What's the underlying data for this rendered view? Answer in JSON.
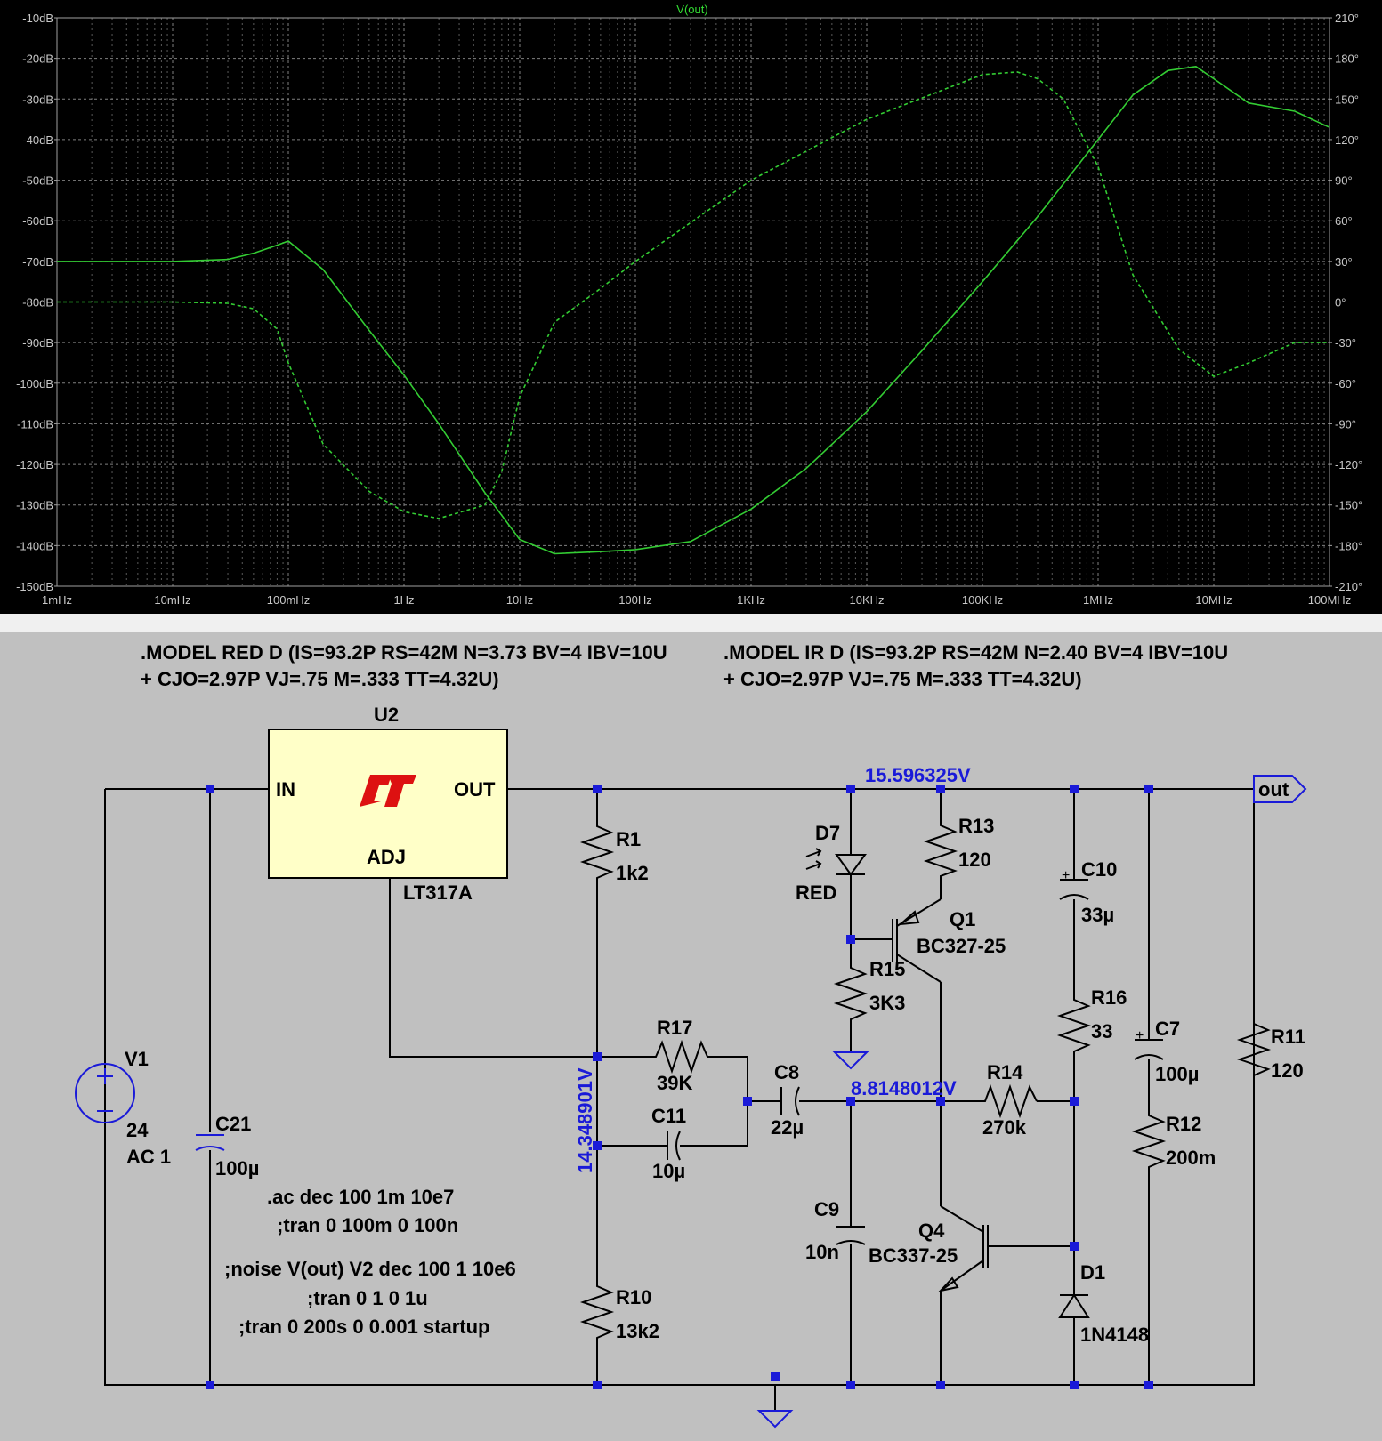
{
  "plot": {
    "trace_name": "V(out)",
    "y_left_ticks": [
      "-10dB",
      "-20dB",
      "-30dB",
      "-40dB",
      "-50dB",
      "-60dB",
      "-70dB",
      "-80dB",
      "-90dB",
      "-100dB",
      "-110dB",
      "-120dB",
      "-130dB",
      "-140dB",
      "-150dB"
    ],
    "y_right_ticks": [
      "210°",
      "180°",
      "150°",
      "120°",
      "90°",
      "60°",
      "30°",
      "0°",
      "-30°",
      "-60°",
      "-90°",
      "-120°",
      "-150°",
      "-180°",
      "-210°"
    ],
    "x_ticks": [
      "1mHz",
      "10mHz",
      "100mHz",
      "1Hz",
      "10Hz",
      "100Hz",
      "1KHz",
      "10KHz",
      "100KHz",
      "1MHz",
      "10MHz",
      "100MHz"
    ],
    "colors": {
      "background": "#000000",
      "grid": "#808080",
      "trace": "#33cc33",
      "axis_text": "#c8c8c8"
    }
  },
  "chart_data": {
    "type": "line",
    "title": "V(out)",
    "xscale": "log",
    "xlim": [
      0.001,
      100000000
    ],
    "ylim": [
      -150,
      -10
    ],
    "y2lim": [
      -210,
      210
    ],
    "grid": true,
    "series": [
      {
        "name": "V(out)",
        "axis": "magnitude_dB",
        "style": "solid",
        "x": [
          0.001,
          0.01,
          0.03,
          0.05,
          0.08,
          0.1,
          0.2,
          0.5,
          1,
          2,
          5,
          10,
          20,
          50,
          100,
          300,
          1000,
          3000,
          10000,
          30000,
          100000,
          300000,
          1000000,
          2000000,
          4000000,
          7000000,
          10000000,
          20000000,
          50000000,
          100000000
        ],
        "y": [
          -70,
          -70,
          -69.5,
          -68,
          -66,
          -65,
          -72,
          -87,
          -98,
          -110,
          -127,
          -138.5,
          -142,
          -141.5,
          -141,
          -139,
          -131,
          -121,
          -107,
          -92,
          -75,
          -59,
          -40,
          -29,
          -23,
          -22,
          -25,
          -31,
          -33,
          -37
        ]
      },
      {
        "name": "V(out)",
        "axis": "phase_deg",
        "style": "dashed",
        "x": [
          0.001,
          0.01,
          0.03,
          0.05,
          0.08,
          0.1,
          0.2,
          0.5,
          1,
          2,
          5,
          7,
          10,
          20,
          50,
          100,
          1000,
          10000,
          100000,
          200000,
          300000,
          500000,
          1000000,
          2000000,
          5000000,
          10000000,
          20000000,
          50000000,
          100000000
        ],
        "y": [
          0,
          0,
          -1,
          -5,
          -20,
          -45,
          -105,
          -140,
          -155,
          -160,
          -150,
          -125,
          -70,
          -15,
          10,
          30,
          90,
          135,
          168,
          170,
          165,
          150,
          100,
          20,
          -35,
          -55,
          -45,
          -30,
          -30
        ]
      }
    ]
  },
  "schematic": {
    "model_red_line1": ".MODEL RED D (IS=93.2P RS=42M N=3.73 BV=4 IBV=10U",
    "model_red_line2": "+ CJO=2.97P VJ=.75 M=.333 TT=4.32U)",
    "model_ir_line1": ".MODEL IR D (IS=93.2P RS=42M N=2.40 BV=4 IBV=10U",
    "model_ir_line2": "+ CJO=2.97P VJ=.75 M=.333 TT=4.32U)",
    "u2": {
      "ref": "U2",
      "part": "LT317A",
      "pin_in": "IN",
      "pin_out": "OUT",
      "pin_adj": "ADJ",
      "logo": "LT"
    },
    "net_voltages": {
      "top_rail": "15.596325V",
      "adj": "14.348901V",
      "mid": "8.8148012V"
    },
    "out_label": "out",
    "components": {
      "v1": {
        "ref": "V1",
        "value": "24",
        "value2": "AC 1"
      },
      "c21": {
        "ref": "C21",
        "value": "100µ"
      },
      "r1": {
        "ref": "R1",
        "value": "1k2"
      },
      "r10": {
        "ref": "R10",
        "value": "13k2"
      },
      "r17": {
        "ref": "R17",
        "value": "39K"
      },
      "c11": {
        "ref": "C11",
        "value": "10µ"
      },
      "c8": {
        "ref": "C8",
        "value": "22µ"
      },
      "c9": {
        "ref": "C9",
        "value": "10n"
      },
      "d7": {
        "ref": "D7",
        "value": "RED"
      },
      "r15": {
        "ref": "R15",
        "value": "3K3"
      },
      "r13": {
        "ref": "R13",
        "value": "120"
      },
      "q1": {
        "ref": "Q1",
        "value": "BC327-25"
      },
      "q4": {
        "ref": "Q4",
        "value": "BC337-25"
      },
      "r14": {
        "ref": "R14",
        "value": "270k"
      },
      "c10": {
        "ref": "C10",
        "value": "33µ"
      },
      "r16": {
        "ref": "R16",
        "value": "33"
      },
      "d1": {
        "ref": "D1",
        "value": "1N4148"
      },
      "c7": {
        "ref": "C7",
        "value": "100µ"
      },
      "r12": {
        "ref": "R12",
        "value": "200m"
      },
      "r11": {
        "ref": "R11",
        "value": "120"
      }
    },
    "directives": [
      ".ac dec 100 1m 10e7",
      ";tran 0 100m 0 100n",
      ";noise V(out) V2 dec 100 1 10e6",
      ";tran 0 1 0 1u",
      ";tran 0 200s 0 0.001 startup"
    ]
  }
}
